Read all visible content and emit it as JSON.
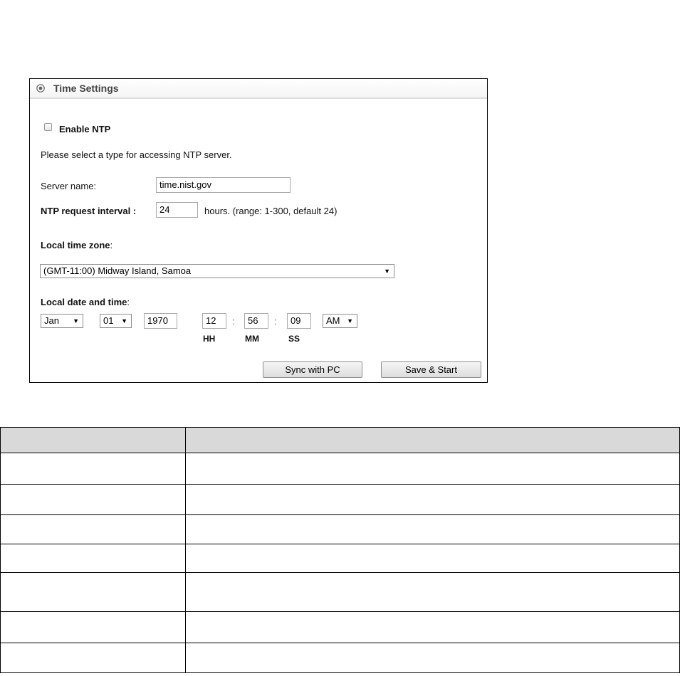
{
  "panel": {
    "title": "Time Settings",
    "enable_ntp": {
      "label": "Enable NTP",
      "checked": false
    },
    "instruction": "Please select a type for accessing NTP server.",
    "server_name": {
      "label": "Server name:",
      "value": "time.nist.gov"
    },
    "ntp_interval": {
      "label": "NTP request interval :",
      "value": "24",
      "hint": "hours. (range: 1-300, default 24)"
    },
    "timezone": {
      "label": "Local time zone",
      "colon": ":",
      "selected": "(GMT-11:00) Midway Island, Samoa"
    },
    "datetime": {
      "label": "Local date and time",
      "colon": ":",
      "month": "Jan",
      "day": "01",
      "year": "1970",
      "hour": "12",
      "minute": "56",
      "second": "09",
      "ampm": "AM",
      "sep": ":",
      "hh_label": "HH",
      "mm_label": "MM",
      "ss_label": "SS"
    },
    "sync_button": "Sync with PC",
    "save_button": "Save & Start",
    "dropdown_caret": "▼"
  },
  "table": {
    "headers": [
      "",
      ""
    ],
    "rows": [
      [
        "",
        ""
      ],
      [
        "",
        ""
      ],
      [
        "",
        ""
      ],
      [
        "",
        ""
      ],
      [
        "",
        ""
      ],
      [
        "",
        ""
      ],
      [
        "",
        ""
      ]
    ]
  }
}
